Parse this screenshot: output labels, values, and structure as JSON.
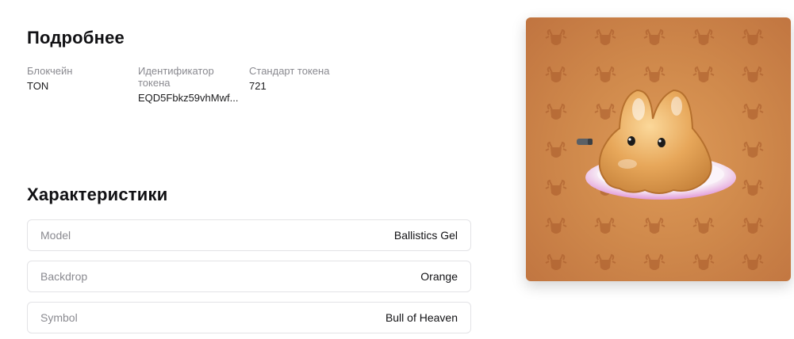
{
  "details": {
    "title": "Подробнее",
    "fields": [
      {
        "label": "Блокчейн",
        "value": "TON"
      },
      {
        "label": "Идентификатор токена",
        "value": "EQD5Fbkz59vhMwf..."
      },
      {
        "label": "Стандарт токена",
        "value": "721"
      }
    ]
  },
  "characteristics": {
    "title": "Характеристики",
    "traits": [
      {
        "name": "Model",
        "value": "Ballistics Gel"
      },
      {
        "name": "Backdrop",
        "value": "Orange"
      },
      {
        "name": "Symbol",
        "value": "Bull of Heaven"
      }
    ]
  },
  "nft_image": {
    "subject": "ballistics-gel-creature",
    "backdrop_color": "#d08a4c",
    "pattern_icon": "bull-head-icon"
  }
}
